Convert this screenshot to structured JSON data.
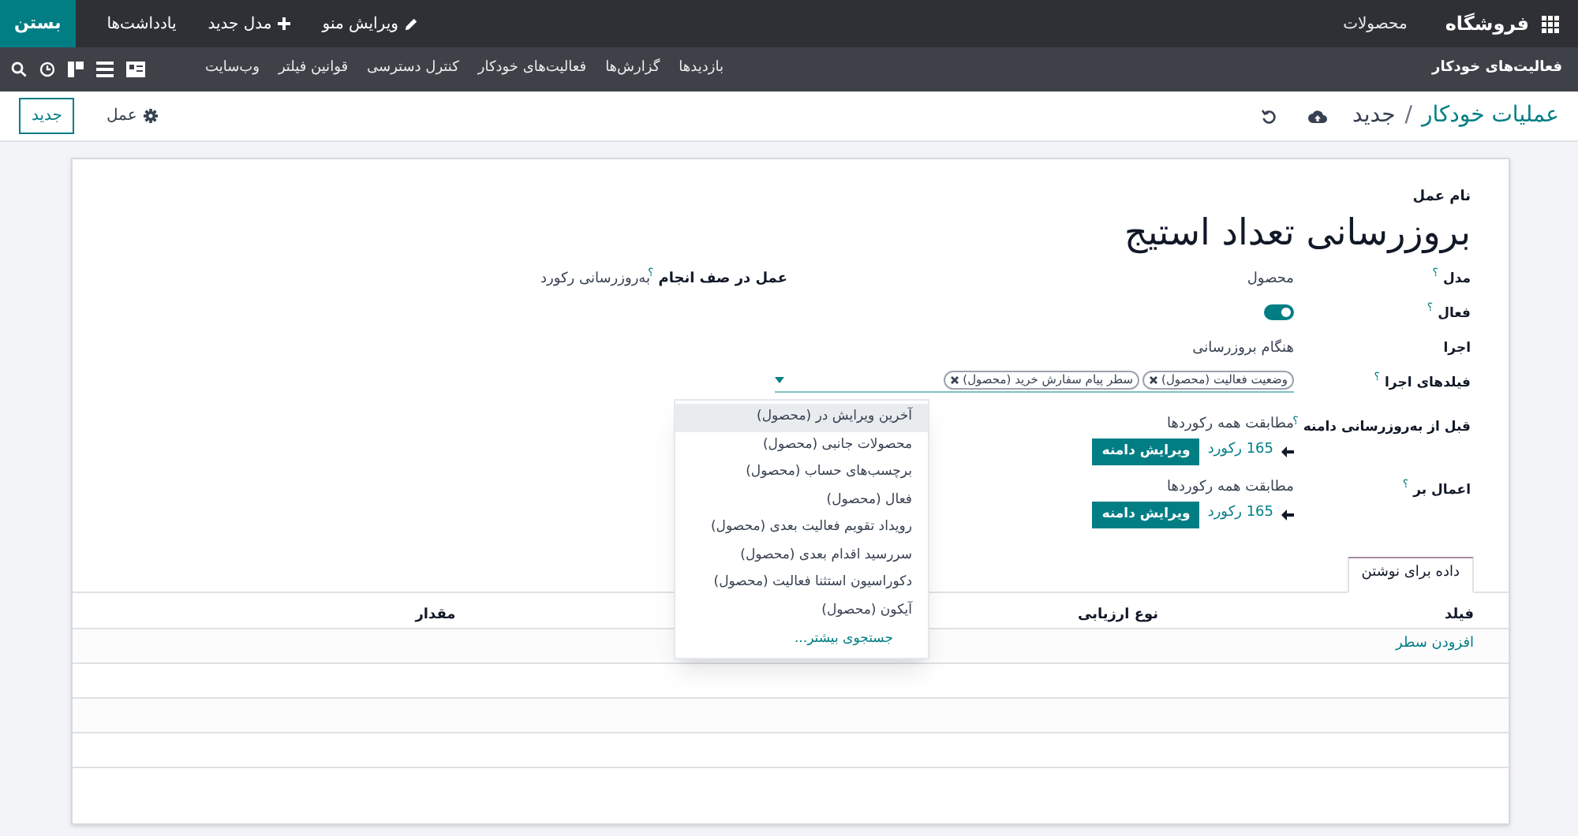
{
  "top_bar": {
    "app_name": "فروشگاه",
    "menu": [
      "محصولات"
    ],
    "actions": [
      {
        "kind": "edit",
        "label": "ویرایش منو"
      },
      {
        "kind": "add",
        "label": "مدل جدید"
      },
      {
        "kind": "plain",
        "label": "یادداشت‌ها"
      }
    ],
    "close_button": "بستن"
  },
  "sub_bar": {
    "title": "فعالیت‌های خودکار",
    "menu": [
      "بازدیدها",
      "گزارش‌ها",
      "فعالیت‌های خودکار",
      "کنترل دسترسی",
      "قوانین فیلتر",
      "وب‌سایت"
    ]
  },
  "control_panel": {
    "breadcrumb": [
      {
        "label": "عملیات خودکار"
      },
      {
        "label": "جدید"
      }
    ],
    "separator": "/",
    "action_button": "عمل",
    "new_button": "جدید"
  },
  "form": {
    "name_label": "نام عمل",
    "name": "بروزرسانی تعداد استیج",
    "fields": [
      {
        "kind": "text",
        "label": "مدل",
        "help": "؟",
        "value": "محصول"
      },
      {
        "kind": "toggle",
        "label": "فعال",
        "help": "؟",
        "on": true
      },
      {
        "kind": "text",
        "label": "اجرا",
        "value": "هنگام بروزرسانی"
      },
      {
        "kind": "tags",
        "label": "فیلدهای اجرا",
        "help": "؟",
        "tags": [
          "وضعیت فعالیت (محصول)",
          "سطر پیام سفارش خرید (محصول)"
        ]
      },
      {
        "kind": "domain",
        "label": "قبل از به‌روزرسانی دامنه",
        "help": "؟",
        "summary": "مطابقت همه رکوردها",
        "count": "165 رکورد",
        "button": "ویرایش دامنه"
      },
      {
        "kind": "domain",
        "label": "اعمال بر",
        "help": "؟",
        "summary": "مطابقت همه رکوردها",
        "count": "165 رکورد",
        "button": "ویرایش دامنه"
      }
    ],
    "side_fields": [
      {
        "kind": "text",
        "label": "عمل در صف انجام",
        "help": "؟",
        "value": "به‌روزرسانی رکورد"
      }
    ],
    "dropdown": {
      "items": [
        {
          "label": "آخرین ویرایش در (محصول)",
          "selected": true
        },
        {
          "label": "محصولات جانبی (محصول)",
          "selected": false
        },
        {
          "label": "برچسب‌های حساب (محصول)",
          "selected": false
        },
        {
          "label": "فعال (محصول)",
          "selected": false
        },
        {
          "label": "رویداد تقویم فعالیت بعدی (محصول)",
          "selected": false
        },
        {
          "label": "سررسید اقدام بعدی (محصول)",
          "selected": false
        },
        {
          "label": "دکوراسیون استثنا فعالیت (محصول)",
          "selected": false
        },
        {
          "label": "آیکون (محصول)",
          "selected": false
        }
      ],
      "more": "جستجوی بیشتر..."
    },
    "notebook": {
      "tabs": [
        {
          "label": "داده برای نوشتن",
          "selected": true
        }
      ],
      "table": {
        "columns": [
          "فیلد",
          "نوع ارزیابی",
          "مقدار"
        ],
        "add_line": "افزودن سطر"
      }
    }
  }
}
